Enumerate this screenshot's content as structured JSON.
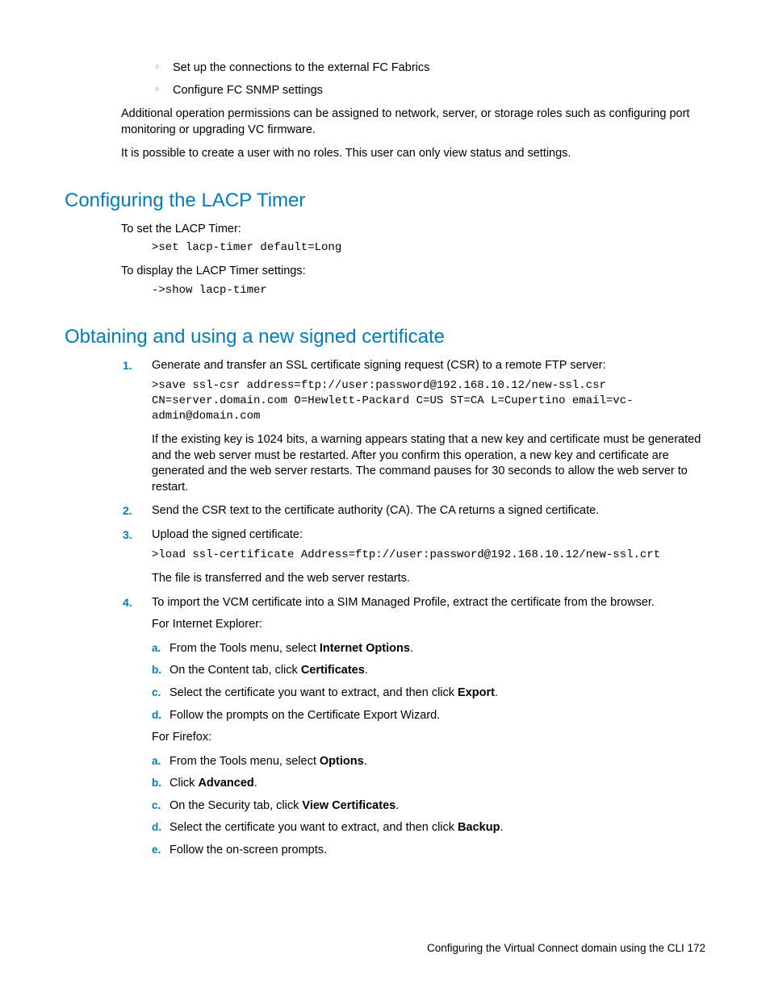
{
  "top_bullets": [
    "Set up the connections to the external FC Fabrics",
    "Configure FC SNMP settings"
  ],
  "intro_paras": [
    "Additional operation permissions can be assigned to network, server, or storage roles such as configuring port monitoring or upgrading VC firmware.",
    "It is possible to create a user with no roles. This user can only view status and settings."
  ],
  "section1": {
    "heading": "Configuring the LACP Timer",
    "para1": "To set the LACP Timer:",
    "code1": ">set lacp-timer default=Long",
    "para2": "To display the LACP Timer settings:",
    "code2": "->show lacp-timer"
  },
  "section2": {
    "heading": "Obtaining and using a new signed certificate",
    "step1_text": "Generate and transfer an SSL certificate signing request (CSR) to a remote FTP server:",
    "step1_code": ">save ssl-csr address=ftp://user:password@192.168.10.12/new-ssl.csr CN=server.domain.com O=Hewlett-Packard C=US ST=CA L=Cupertino email=vc-admin@domain.com",
    "step1_after": "If the existing key is 1024 bits, a warning appears stating that a new key and certificate must be generated and the web server must be restarted. After you confirm this operation, a new key and certificate are generated and the web server restarts. The command pauses for 30 seconds to allow the web server to restart.",
    "step2_text": "Send the CSR text to the certificate authority (CA). The CA returns a signed certificate.",
    "step3_text": "Upload the signed certificate:",
    "step3_code": ">load ssl-certificate Address=ftp://user:password@192.168.10.12/new-ssl.crt",
    "step3_after": "The file is transferred and the web server restarts.",
    "step4_text": "To import the VCM certificate into a SIM Managed Profile, extract the certificate from the browser.",
    "step4_ie_intro": "For Internet Explorer:",
    "step4_ie": {
      "a_pre": "From the Tools menu, select ",
      "a_bold": "Internet Options",
      "a_post": ".",
      "b_pre": "On the Content tab, click ",
      "b_bold": "Certificates",
      "b_post": ".",
      "c_pre": "Select the certificate you want to extract, and then click ",
      "c_bold": "Export",
      "c_post": ".",
      "d": "Follow the prompts on the Certificate Export Wizard."
    },
    "step4_ff_intro": "For Firefox:",
    "step4_ff": {
      "a_pre": "From the Tools menu, select ",
      "a_bold": "Options",
      "a_post": ".",
      "b_pre": "Click ",
      "b_bold": "Advanced",
      "b_post": ".",
      "c_pre": "On the Security tab, click ",
      "c_bold": "View Certificates",
      "c_post": ".",
      "d_pre": "Select the certificate you want to extract, and then click ",
      "d_bold": "Backup",
      "d_post": ".",
      "e": "Follow the on-screen prompts."
    }
  },
  "footer": "Configuring the Virtual Connect domain using the CLI   172"
}
